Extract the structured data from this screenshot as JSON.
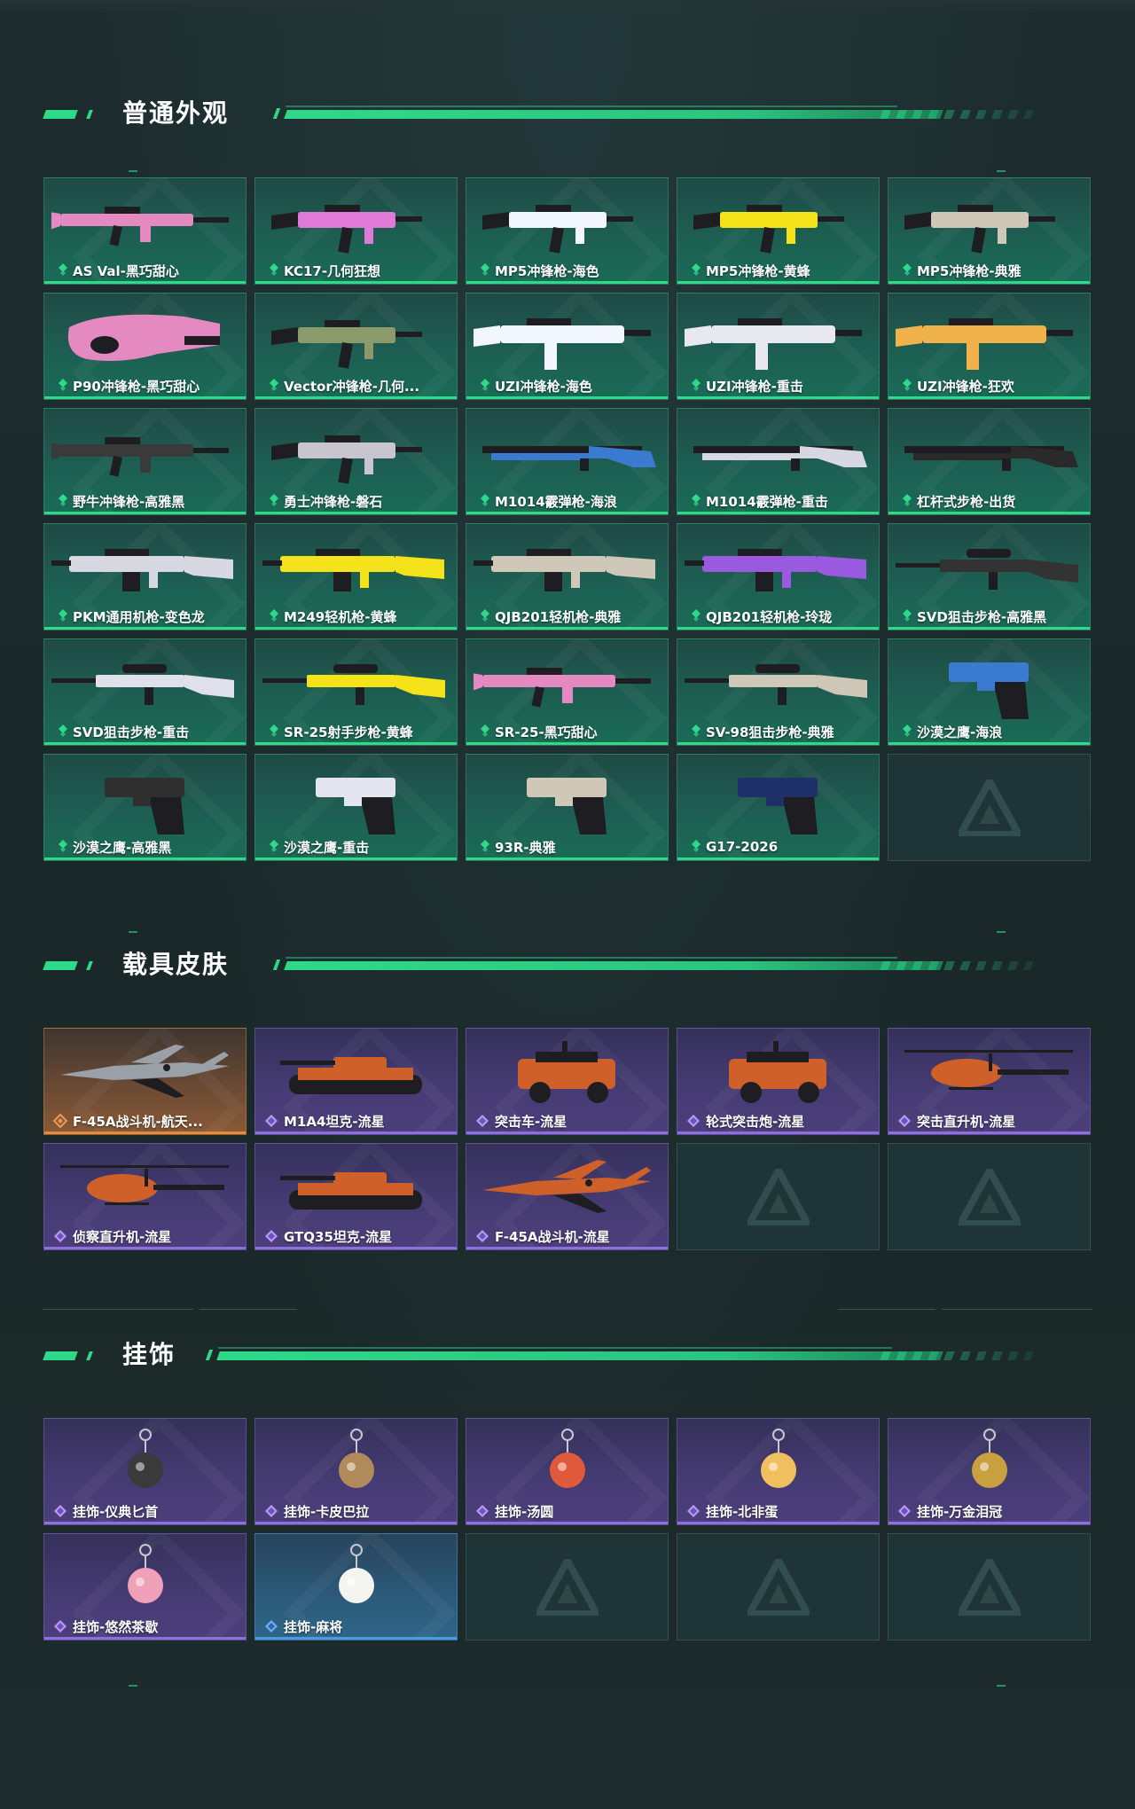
{
  "sections": {
    "weapons": {
      "title": "普通外观",
      "items": [
        {
          "label": "AS Val-黑巧甜心",
          "color": "#e58ac0",
          "kind": "rifle"
        },
        {
          "label": "KC17-几何狂想",
          "color": "#e07ad8",
          "kind": "smg"
        },
        {
          "label": "MP5冲锋枪-海色",
          "color": "#f2f6ff",
          "kind": "smg"
        },
        {
          "label": "MP5冲锋枪-黄蜂",
          "color": "#f4e21a",
          "kind": "smg"
        },
        {
          "label": "MP5冲锋枪-典雅",
          "color": "#cfc8b8",
          "kind": "smg"
        },
        {
          "label": "P90冲锋枪-黑巧甜心",
          "color": "#e58ac0",
          "kind": "p90"
        },
        {
          "label": "Vector冲锋枪-几何...",
          "color": "#8a9a6a",
          "kind": "smg"
        },
        {
          "label": "UZI冲锋枪-海色",
          "color": "#f2f6ff",
          "kind": "uzi"
        },
        {
          "label": "UZI冲锋枪-重击",
          "color": "#e8e8f0",
          "kind": "uzi"
        },
        {
          "label": "UZI冲锋枪-狂欢",
          "color": "#f0b24a",
          "kind": "uzi"
        },
        {
          "label": "野牛冲锋枪-高雅黑",
          "color": "#3a3a3a",
          "kind": "rifle"
        },
        {
          "label": "勇士冲锋枪-磐石",
          "color": "#c8c4d0",
          "kind": "smg"
        },
        {
          "label": "M1014霰弹枪-海浪",
          "color": "#3a7ad0",
          "kind": "shotgun"
        },
        {
          "label": "M1014霰弹枪-重击",
          "color": "#d8d8e4",
          "kind": "shotgun"
        },
        {
          "label": "杠杆式步枪-出货",
          "color": "#2a2a2a",
          "kind": "shotgun"
        },
        {
          "label": "PKM通用机枪-变色龙",
          "color": "#d8d8e2",
          "kind": "mg"
        },
        {
          "label": "M249轻机枪-黄蜂",
          "color": "#f4e21a",
          "kind": "mg"
        },
        {
          "label": "QJB201轻机枪-典雅",
          "color": "#cfc8b8",
          "kind": "mg"
        },
        {
          "label": "QJB201轻机枪-玲珑",
          "color": "#9a5ae0",
          "kind": "mg"
        },
        {
          "label": "SVD狙击步枪-高雅黑",
          "color": "#333333",
          "kind": "sniper"
        },
        {
          "label": "SVD狙击步枪-重击",
          "color": "#e0e0ea",
          "kind": "sniper"
        },
        {
          "label": "SR-25射手步枪-黄蜂",
          "color": "#f4e21a",
          "kind": "sniper"
        },
        {
          "label": "SR-25-黑巧甜心",
          "color": "#e58ac0",
          "kind": "rifle"
        },
        {
          "label": "SV-98狙击步枪-典雅",
          "color": "#cfc8b8",
          "kind": "sniper"
        },
        {
          "label": "沙漠之鹰-海浪",
          "color": "#3a7ad0",
          "kind": "pistol"
        },
        {
          "label": "沙漠之鹰-高雅黑",
          "color": "#2f2f2f",
          "kind": "pistol"
        },
        {
          "label": "沙漠之鹰-重击",
          "color": "#e4e4ee",
          "kind": "pistol"
        },
        {
          "label": "93R-典雅",
          "color": "#cfc8b8",
          "kind": "pistol"
        },
        {
          "label": "G17-2026",
          "color": "#1f2f6a",
          "kind": "pistol"
        },
        {
          "label": "",
          "color": "",
          "kind": "empty"
        }
      ]
    },
    "vehicles": {
      "title": "载具皮肤",
      "items": [
        {
          "label": "F-45A战斗机-航天...",
          "color": "#9aa0a8",
          "kind": "jet",
          "tier": "gold"
        },
        {
          "label": "M1A4坦克-流星",
          "color": "#d0602a",
          "kind": "tank",
          "tier": "vehicle"
        },
        {
          "label": "突击车-流星",
          "color": "#d0602a",
          "kind": "car",
          "tier": "vehicle"
        },
        {
          "label": "轮式突击炮-流星",
          "color": "#d0602a",
          "kind": "car",
          "tier": "vehicle"
        },
        {
          "label": "突击直升机-流星",
          "color": "#d0602a",
          "kind": "heli",
          "tier": "vehicle"
        },
        {
          "label": "侦察直升机-流星",
          "color": "#d0602a",
          "kind": "heli",
          "tier": "vehicle"
        },
        {
          "label": "GTQ35坦克-流星",
          "color": "#d0602a",
          "kind": "tank",
          "tier": "vehicle"
        },
        {
          "label": "F-45A战斗机-流星",
          "color": "#d0602a",
          "kind": "jet",
          "tier": "vehicle"
        },
        {
          "label": "",
          "color": "",
          "kind": "empty",
          "tier": "empty"
        },
        {
          "label": "",
          "color": "",
          "kind": "empty",
          "tier": "empty"
        }
      ]
    },
    "charms": {
      "title": "挂饰",
      "items": [
        {
          "label": "挂饰-仪典匕首",
          "color": "#3a3a3a",
          "kind": "charm",
          "tier": "vehicle"
        },
        {
          "label": "挂饰-卡皮巴拉",
          "color": "#b08a5a",
          "kind": "charm",
          "tier": "vehicle"
        },
        {
          "label": "挂饰-汤圆",
          "color": "#e05a3a",
          "kind": "charm",
          "tier": "vehicle"
        },
        {
          "label": "挂饰-北非蛋",
          "color": "#f0c060",
          "kind": "charm",
          "tier": "vehicle"
        },
        {
          "label": "挂饰-万金泪冠",
          "color": "#c8a040",
          "kind": "charm",
          "tier": "vehicle"
        },
        {
          "label": "挂饰-悠然茶歇",
          "color": "#f0a0b8",
          "kind": "charm",
          "tier": "vehicle"
        },
        {
          "label": "挂饰-麻将",
          "color": "#f4f4f0",
          "kind": "charm",
          "tier": "blue"
        },
        {
          "label": "",
          "color": "",
          "kind": "empty",
          "tier": "empty"
        },
        {
          "label": "",
          "color": "",
          "kind": "empty",
          "tier": "empty"
        },
        {
          "label": "",
          "color": "",
          "kind": "empty",
          "tier": "empty"
        }
      ]
    }
  },
  "colors": {
    "accent": "#2fd98a",
    "vehicle_accent": "#8f6ee0",
    "gold_accent": "#e88a3b",
    "blue_accent": "#4a9be6"
  }
}
